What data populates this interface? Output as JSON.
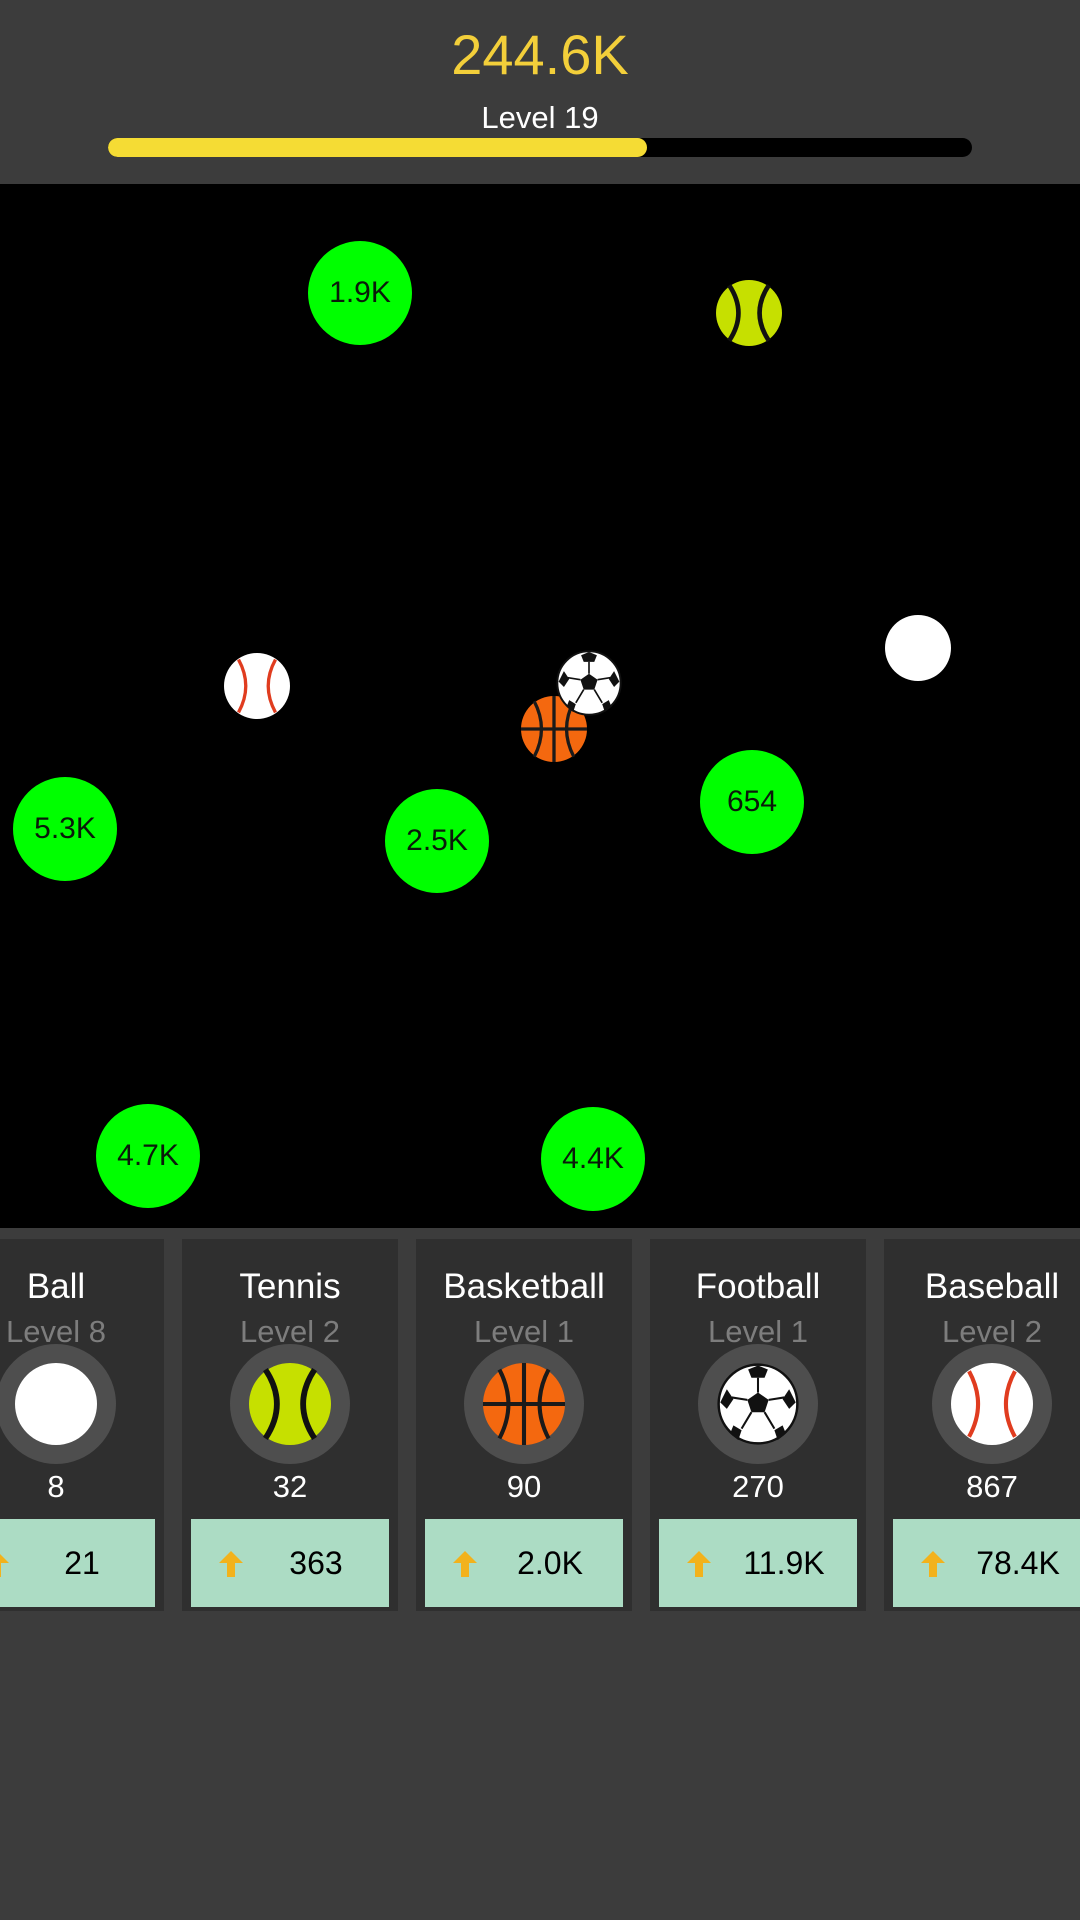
{
  "header": {
    "money": "244.6K",
    "level_label": "Level 19",
    "progress": 0.624,
    "progress_color": "#f5dc34"
  },
  "field": {
    "bricks": [
      "1.9K",
      "5.3K",
      "2.5K",
      "654",
      "4.7K",
      "4.4K"
    ],
    "balls": [
      "tennis-ball",
      "plain-ball",
      "baseball",
      "soccer-ball",
      "basketball"
    ]
  },
  "shop": {
    "cards": [
      {
        "name": "Ball",
        "level": "Level 8",
        "count": "8",
        "cost": "21",
        "icon": "plain-ball"
      },
      {
        "name": "Tennis",
        "level": "Level 2",
        "count": "32",
        "cost": "363",
        "icon": "tennis-ball"
      },
      {
        "name": "Basketball",
        "level": "Level 1",
        "count": "90",
        "cost": "2.0K",
        "icon": "basketball"
      },
      {
        "name": "Football",
        "level": "Level 1",
        "count": "270",
        "cost": "11.9K",
        "icon": "soccer-ball"
      },
      {
        "name": "Baseball",
        "level": "Level 2",
        "count": "867",
        "cost": "78.4K",
        "icon": "baseball"
      }
    ],
    "upgrade_icon": "up-arrow-icon"
  },
  "colors": {
    "money": "#f3cf3a",
    "brick": "#00ff00",
    "upgrade_button": "#acdcc4",
    "background": "#3c3c3c"
  }
}
